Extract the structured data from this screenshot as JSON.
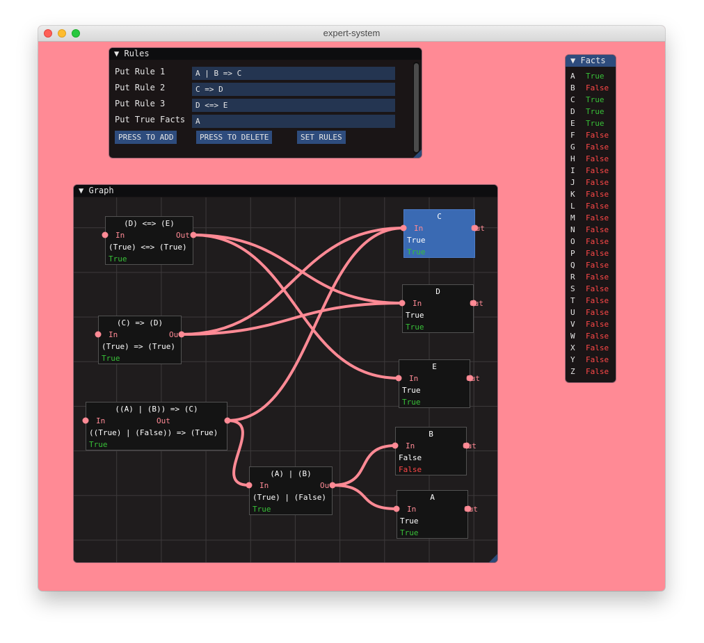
{
  "window": {
    "title": "expert-system"
  },
  "rules": {
    "title": "Rules",
    "rows": [
      {
        "label": "Put Rule 1",
        "value": "A | B => C"
      },
      {
        "label": "Put Rule 2",
        "value": "C => D"
      },
      {
        "label": "Put Rule 3",
        "value": "D <=> E"
      },
      {
        "label": "Put True Facts",
        "value": "A"
      }
    ],
    "buttons": {
      "add": "PRESS TO ADD",
      "delete": "PRESS TO DELETE",
      "set": "SET RULES"
    }
  },
  "facts": {
    "title": "Facts",
    "items": [
      {
        "letter": "A",
        "value": "True"
      },
      {
        "letter": "B",
        "value": "False"
      },
      {
        "letter": "C",
        "value": "True"
      },
      {
        "letter": "D",
        "value": "True"
      },
      {
        "letter": "E",
        "value": "True"
      },
      {
        "letter": "F",
        "value": "False"
      },
      {
        "letter": "G",
        "value": "False"
      },
      {
        "letter": "H",
        "value": "False"
      },
      {
        "letter": "I",
        "value": "False"
      },
      {
        "letter": "J",
        "value": "False"
      },
      {
        "letter": "K",
        "value": "False"
      },
      {
        "letter": "L",
        "value": "False"
      },
      {
        "letter": "M",
        "value": "False"
      },
      {
        "letter": "N",
        "value": "False"
      },
      {
        "letter": "O",
        "value": "False"
      },
      {
        "letter": "P",
        "value": "False"
      },
      {
        "letter": "Q",
        "value": "False"
      },
      {
        "letter": "R",
        "value": "False"
      },
      {
        "letter": "S",
        "value": "False"
      },
      {
        "letter": "T",
        "value": "False"
      },
      {
        "letter": "U",
        "value": "False"
      },
      {
        "letter": "V",
        "value": "False"
      },
      {
        "letter": "W",
        "value": "False"
      },
      {
        "letter": "X",
        "value": "False"
      },
      {
        "letter": "Y",
        "value": "False"
      },
      {
        "letter": "Z",
        "value": "False"
      }
    ]
  },
  "graph": {
    "title": "Graph",
    "in_label": "In",
    "out_label": "Out",
    "nodes": [
      {
        "id": "DE",
        "title": "(D) <=> (E)",
        "expr": "(True) <=> (True)",
        "result": "True"
      },
      {
        "id": "CD",
        "title": "(C) => (D)",
        "expr": "(True) => (True)",
        "result": "True"
      },
      {
        "id": "ABC",
        "title": "((A) | (B)) => (C)",
        "expr": "((True) | (False)) => (True)",
        "result": "True"
      },
      {
        "id": "AB",
        "title": "(A) | (B)",
        "expr": "(True) | (False)",
        "result": "True"
      },
      {
        "id": "C",
        "title": "C",
        "expr": "True",
        "result": "True"
      },
      {
        "id": "D",
        "title": "D",
        "expr": "True",
        "result": "True"
      },
      {
        "id": "E",
        "title": "E",
        "expr": "True",
        "result": "True"
      },
      {
        "id": "B",
        "title": "B",
        "expr": "False",
        "result": "False"
      },
      {
        "id": "A",
        "title": "A",
        "expr": "True",
        "result": "True"
      }
    ]
  },
  "colors": {
    "background": "#ff8a95",
    "true": "#38c038",
    "false": "#ff4848",
    "wire": "#ff8a95",
    "selected": "#3a6ab3"
  }
}
